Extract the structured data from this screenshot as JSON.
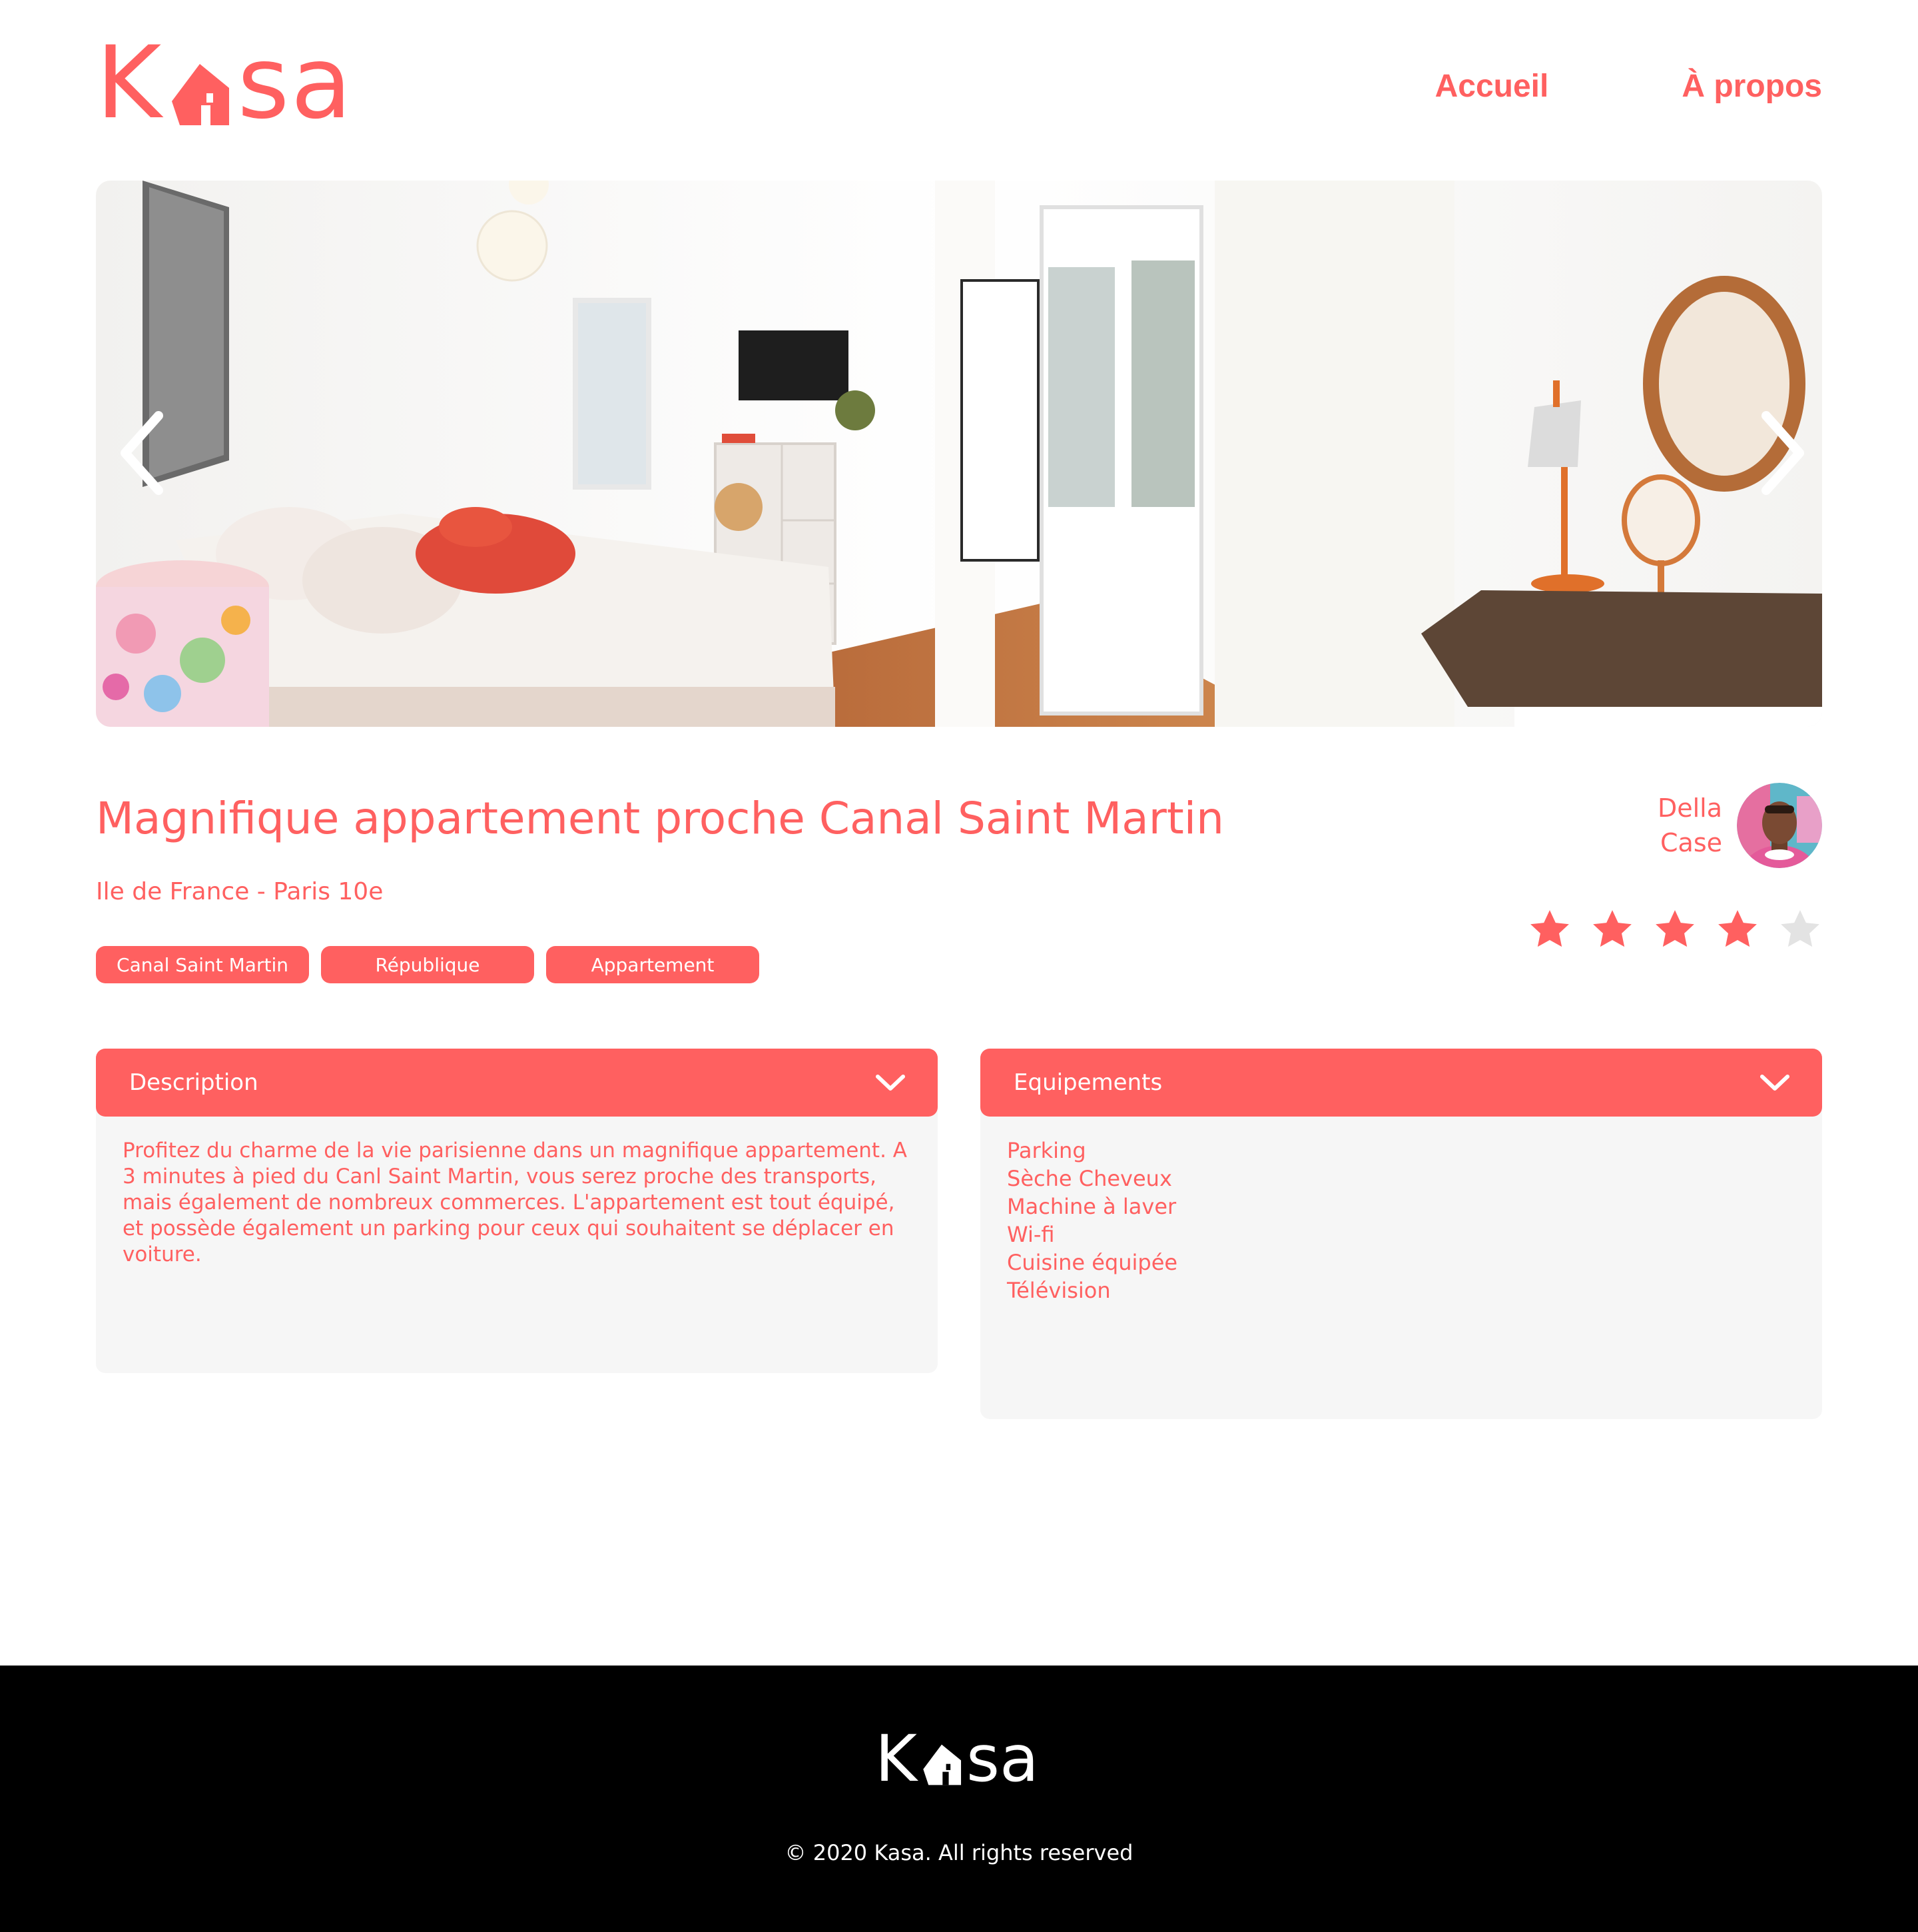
{
  "brand": {
    "logo_text_left": "K",
    "logo_text_right": "sa",
    "color": "#FF6060"
  },
  "nav": {
    "home": "Accueil",
    "about": "À propos"
  },
  "listing": {
    "title": "Magnifique appartement proche Canal Saint Martin",
    "location": "Ile de France - Paris 10e",
    "tags": [
      "Canal Saint Martin",
      "République",
      "Appartement"
    ],
    "host": {
      "first_name": "Della",
      "last_name": "Case"
    },
    "rating": 4,
    "rating_max": 5
  },
  "gallery": {
    "prev_icon": "chevron-left-icon",
    "next_icon": "chevron-right-icon"
  },
  "description": {
    "label": "Description",
    "text": "Profitez du charme de la vie parisienne dans un magnifique appartement. A 3 minutes à pied du Canl Saint Martin, vous serez proche des transports, mais également de nombreux commerces. L'appartement est tout équipé, et possède également un parking pour ceux qui souhaitent se déplacer en voiture."
  },
  "equipments": {
    "label": "Equipements",
    "items": [
      "Parking",
      "Sèche Cheveux",
      "Machine à laver",
      "Wi-fi",
      "Cuisine équipée",
      "Télévision"
    ]
  },
  "footer": {
    "logo_text_left": "K",
    "logo_text_right": "sa",
    "copyright": "© 2020 Kasa. All rights reserved"
  },
  "colors": {
    "accent": "#FF6060",
    "panel_bg": "#F6F6F6",
    "star_off": "#E3E3E3",
    "footer_bg": "#000000"
  }
}
